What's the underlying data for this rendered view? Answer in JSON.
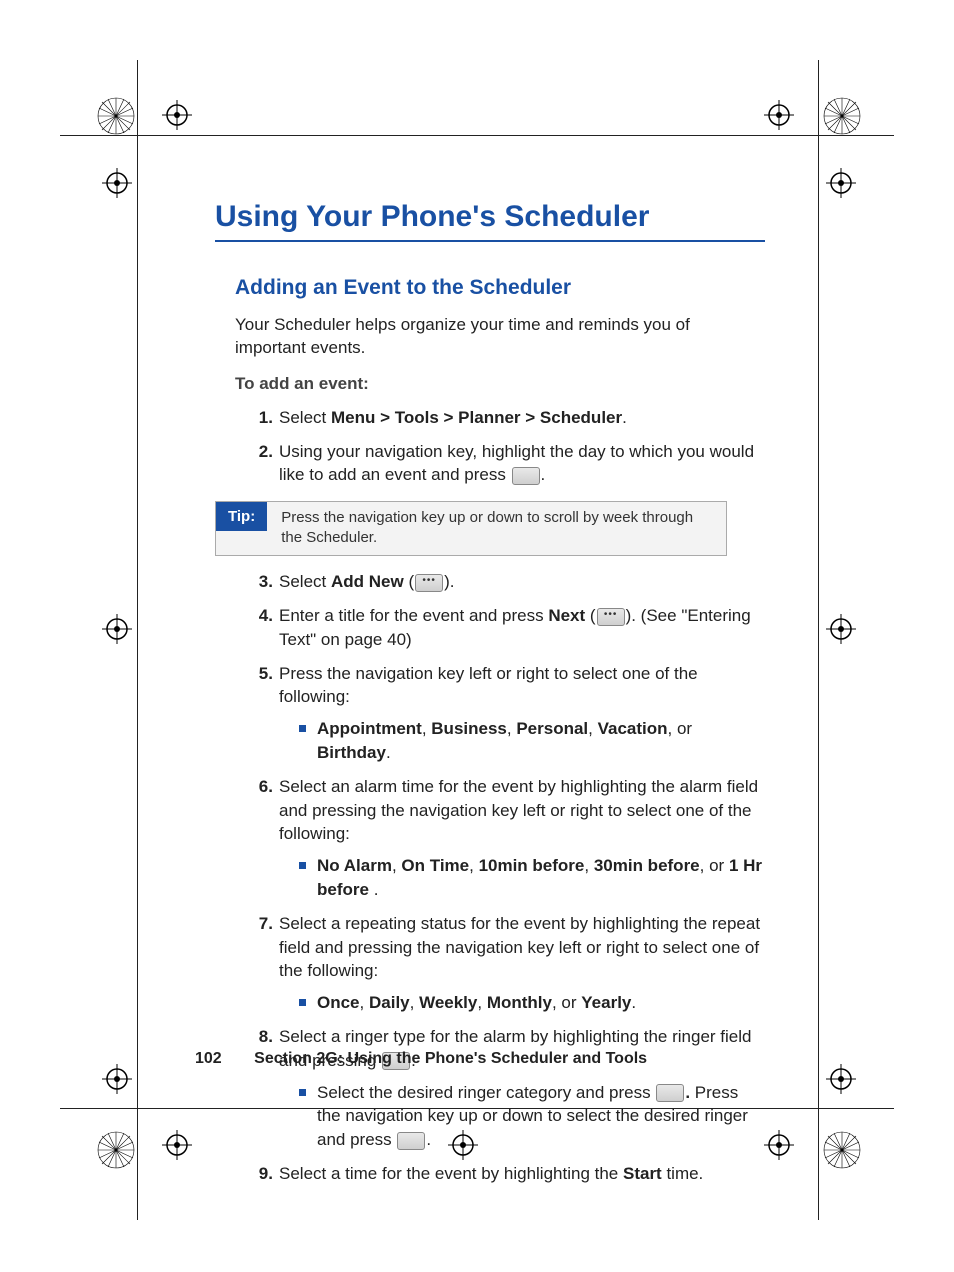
{
  "title": "Using Your Phone's Scheduler",
  "section_heading": "Adding an Event to the Scheduler",
  "intro": "Your Scheduler helps organize your time and reminds you of important events.",
  "lead": "To add an event:",
  "steps": {
    "s1_a": "Select ",
    "s1_b": "Menu > Tools > Planner > Scheduler",
    "s1_c": ".",
    "s2_a": "Using your navigation key, highlight the day to which you would like to add an event and press ",
    "s2_b": ".",
    "s3_a": "Select ",
    "s3_b": "Add New",
    "s3_c": " (",
    "s3_d": ").",
    "s4_a": "Enter a title for the event and press ",
    "s4_b": "Next",
    "s4_c": " (",
    "s4_d": "). (See \"Entering Text\" on page 40)",
    "s5": "Press the navigation key left or right to select one of the following:",
    "s5_sub_a": "Appointment",
    "s5_sub_sep1": ", ",
    "s5_sub_b": "Business",
    "s5_sub_sep2": ", ",
    "s5_sub_c": "Personal",
    "s5_sub_sep3": ", ",
    "s5_sub_d": "Vacation",
    "s5_sub_sep4": ", or ",
    "s5_sub_e": "Birthday",
    "s5_sub_end": ".",
    "s6": "Select an alarm time for the event by highlighting the alarm field and pressing the navigation key left or right to select one of the following:",
    "s6_sub_a": "No Alarm",
    "s6_sub_sep1": ", ",
    "s6_sub_b": "On Time",
    "s6_sub_sep2": ", ",
    "s6_sub_c": "10min before",
    "s6_sub_sep3": ", ",
    "s6_sub_d": "30min before",
    "s6_sub_sep4": ", or ",
    "s6_sub_e": "1 Hr before",
    "s6_sub_end": " .",
    "s7": "Select a repeating status for the event by highlighting the repeat field and pressing the navigation key left or right to select one of the following:",
    "s7_sub_a": "Once",
    "s7_sub_sep1": ", ",
    "s7_sub_b": "Daily",
    "s7_sub_sep2": ", ",
    "s7_sub_c": "Weekly",
    "s7_sub_sep3": ", ",
    "s7_sub_d": "Monthly",
    "s7_sub_sep4": ", or ",
    "s7_sub_e": "Yearly",
    "s7_sub_end": ".",
    "s8_a": "Select a ringer type for the alarm by highlighting the ringer field and pressing ",
    "s8_b": ".",
    "s8_sub_a": "Select the desired ringer category and press ",
    "s8_sub_b": ".",
    "s8_sub_c": " Press the navigation key up or down to select the desired ringer and press ",
    "s8_sub_d": ".",
    "s9_a": "Select a time for the event by highlighting the ",
    "s9_b": "Start",
    "s9_c": " time."
  },
  "tip": {
    "label": "Tip:",
    "text": "Press the navigation key up or down to scroll by week through the Scheduler."
  },
  "footer": {
    "page": "102",
    "section": "Section 2G: Using the Phone's Scheduler and Tools"
  }
}
